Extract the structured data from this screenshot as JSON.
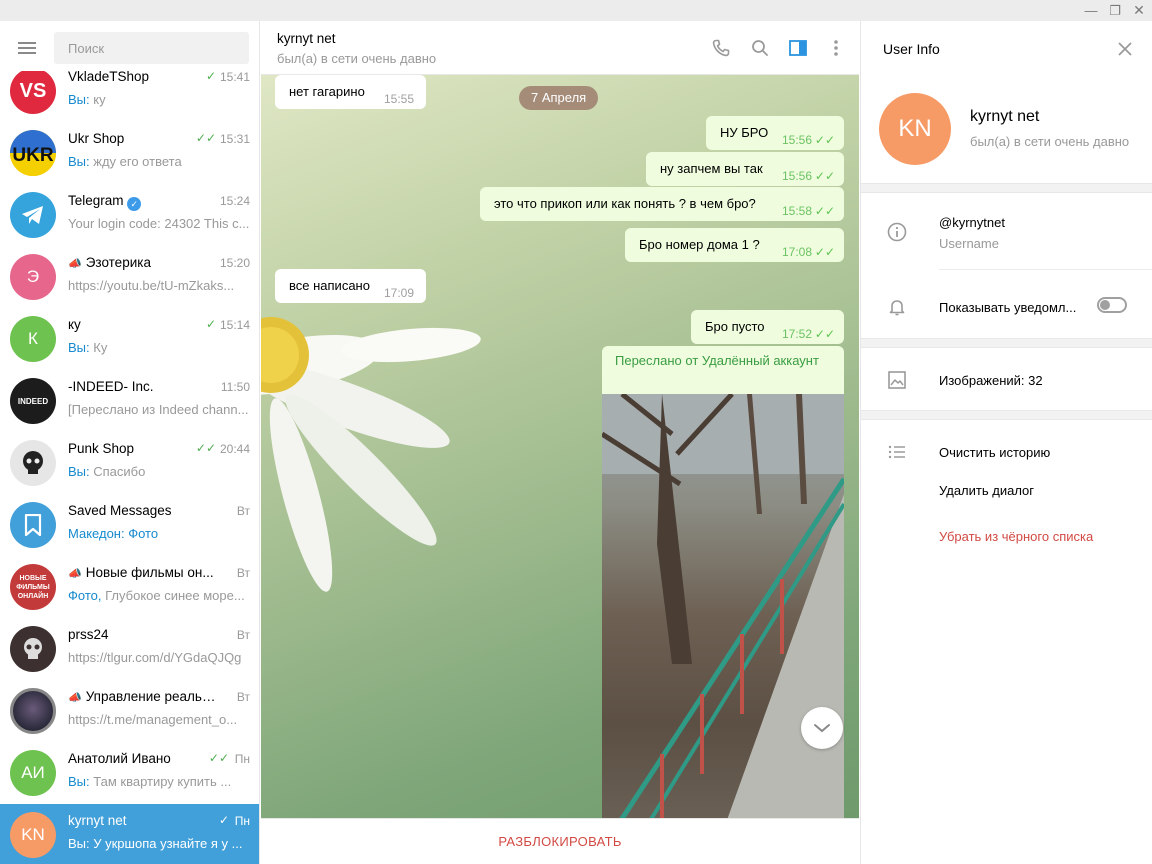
{
  "window": {
    "min_icon": "minimize-icon",
    "max_icon": "restore-icon",
    "close_icon": "close-icon"
  },
  "sidebar": {
    "search_placeholder": "Поиск",
    "chats": [
      {
        "name": "VkladeTShop",
        "time": "15:41",
        "ticks": "✓",
        "preview_prefix": "Вы:",
        "preview": " ку",
        "avatar_text": "VS",
        "avatar_color": "#e0283f"
      },
      {
        "name": "Ukr Shop",
        "time": "15:31",
        "ticks": "✓✓",
        "preview_prefix": "Вы:",
        "preview": " жду его ответа",
        "avatar_text": "UKR",
        "avatar_color": "#f5c800"
      },
      {
        "name": "Telegram",
        "time": "15:24",
        "ticks": "",
        "preview_prefix": "",
        "preview": "Your login code: 24302  This c...",
        "avatar_text": "",
        "avatar_color": "#35a3dc"
      },
      {
        "name": "Эзотерика",
        "time": "15:20",
        "ticks": "",
        "preview_prefix": "",
        "preview": "https://youtu.be/tU-mZkaks...",
        "avatar_text": "Э",
        "avatar_color": "#e7668c"
      },
      {
        "name": "ку",
        "time": "15:14",
        "ticks": "✓",
        "preview_prefix": "Вы:",
        "preview": " Ку",
        "avatar_text": "К",
        "avatar_color": "#6ec250"
      },
      {
        "name": "-INDEED- Inc.",
        "time": "11:50",
        "ticks": "",
        "preview_prefix": "",
        "preview": "[Переслано из Indeed chann...",
        "avatar_text": "INDEED",
        "avatar_color": "#1c1c1c"
      },
      {
        "name": "Punk Shop",
        "time": "20:44",
        "ticks": "✓✓",
        "preview_prefix": "Вы:",
        "preview": " Спасибо",
        "avatar_text": "",
        "avatar_color": "#d8d8d8"
      },
      {
        "name": "Saved Messages",
        "time": "Вт",
        "ticks": "",
        "preview_prefix": "Македон:",
        "preview": " Фото",
        "avatar_text": "",
        "avatar_color": "#419fd9"
      },
      {
        "name": "Новые фильмы он...",
        "time": "Вт",
        "ticks": "",
        "preview_prefix": "Фото,",
        "preview": " Глубокое синее море...",
        "avatar_text": "НОВЫЕ ФИЛЬМЫ ОНЛАЙН",
        "avatar_color": "#c33a3a"
      },
      {
        "name": "prss24",
        "time": "Вт",
        "ticks": "",
        "preview_prefix": "",
        "preview": "https://tlgur.com/d/YGdaQJQg",
        "avatar_text": "",
        "avatar_color": "#3c3030"
      },
      {
        "name": "Управление реальн...",
        "time": "Вт",
        "ticks": "",
        "preview_prefix": "",
        "preview": "https://t.me/management_o...",
        "avatar_text": "",
        "avatar_color": "#3a3a4a"
      },
      {
        "name": "Анатолий Ивано",
        "time": "Пн",
        "ticks": "✓✓",
        "preview_prefix": "Вы:",
        "preview": " Там квартиру купить ...",
        "avatar_text": "АИ",
        "avatar_color": "#6ec250"
      },
      {
        "name": "kyrnyt net",
        "time": "Пн",
        "ticks": "✓",
        "preview_prefix": "Вы:",
        "preview": " У укршопа узнайте я у ...",
        "avatar_text": "KN",
        "avatar_color": "#f79b66"
      }
    ]
  },
  "chat": {
    "peer_name": "kyrnyt net",
    "peer_status": "был(а) в сети очень давно",
    "date_label": "7 Апреля",
    "messages": [
      {
        "text": "нет гагарино",
        "time": "15:55"
      },
      {
        "text": "НУ БРО",
        "time": "15:56"
      },
      {
        "text": "ну запчем вы так",
        "time": "15:56"
      },
      {
        "text": "это что прикоп или как понять ? в чем бро?",
        "time": "15:58"
      },
      {
        "text": "Бро номер дома 1   ?",
        "time": "17:08"
      },
      {
        "text": "все написано",
        "time": "17:09"
      },
      {
        "text": "Бро пусто",
        "time": "17:52"
      }
    ],
    "forwarded_label": "Переслано от Удалённый аккаунт",
    "unblock_label": "РАЗБЛОКИРОВАТЬ"
  },
  "user_info": {
    "title": "User Info",
    "avatar_text": "KN",
    "name": "kyrnyt net",
    "status": "был(а) в сети очень давно",
    "username": "@kyrnytnet",
    "username_label": "Username",
    "notifications_label": "Показывать уведомл...",
    "notifications_on": false,
    "images_label": "Изображений: 32",
    "clear_history": "Очистить историю",
    "delete_dialog": "Удалить диалог",
    "remove_blacklist": "Убрать из чёрного списка"
  }
}
